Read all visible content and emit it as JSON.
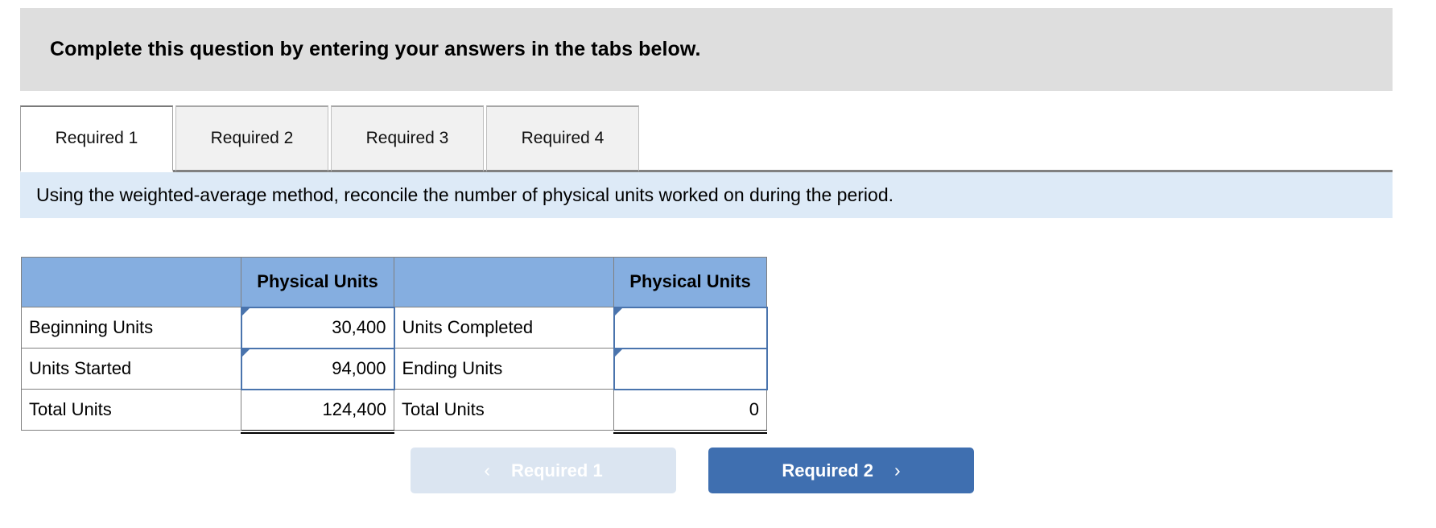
{
  "banner": {
    "text": "Complete this question by entering your answers in the tabs below."
  },
  "tabs": {
    "items": [
      {
        "label": "Required 1",
        "active": true
      },
      {
        "label": "Required 2",
        "active": false
      },
      {
        "label": "Required 3",
        "active": false
      },
      {
        "label": "Required 4",
        "active": false
      }
    ]
  },
  "instruction": {
    "text": "Using the weighted-average method, reconcile the number of physical units worked on during the period."
  },
  "worksheet": {
    "headers": {
      "left_blank": "",
      "left_units": "Physical Units",
      "mid_blank": "",
      "right_units": "Physical Units"
    },
    "rows": [
      {
        "left_label": "Beginning Units",
        "left_value": "30,400",
        "right_label": "Units Completed",
        "right_value": ""
      },
      {
        "left_label": "Units Started",
        "left_value": "94,000",
        "right_label": "Ending Units",
        "right_value": ""
      }
    ],
    "total_row": {
      "left_label": "Total Units",
      "left_value": "124,400",
      "right_label": "Total Units",
      "right_value": "0"
    }
  },
  "navigation": {
    "prev_label": "Required 1",
    "prev_chevron": "chevron-left-icon",
    "prev_chevron_glyph": "‹",
    "next_label": "Required 2",
    "next_chevron": "chevron-right-icon",
    "next_chevron_glyph": "›"
  },
  "colors": {
    "banner_bg": "#dedede",
    "instruction_bg": "#ddeaf7",
    "table_header_bg": "#85aee0",
    "input_border": "#4a74ad",
    "next_button_bg": "#3f6fb0",
    "prev_button_bg": "#dbe5f1"
  }
}
